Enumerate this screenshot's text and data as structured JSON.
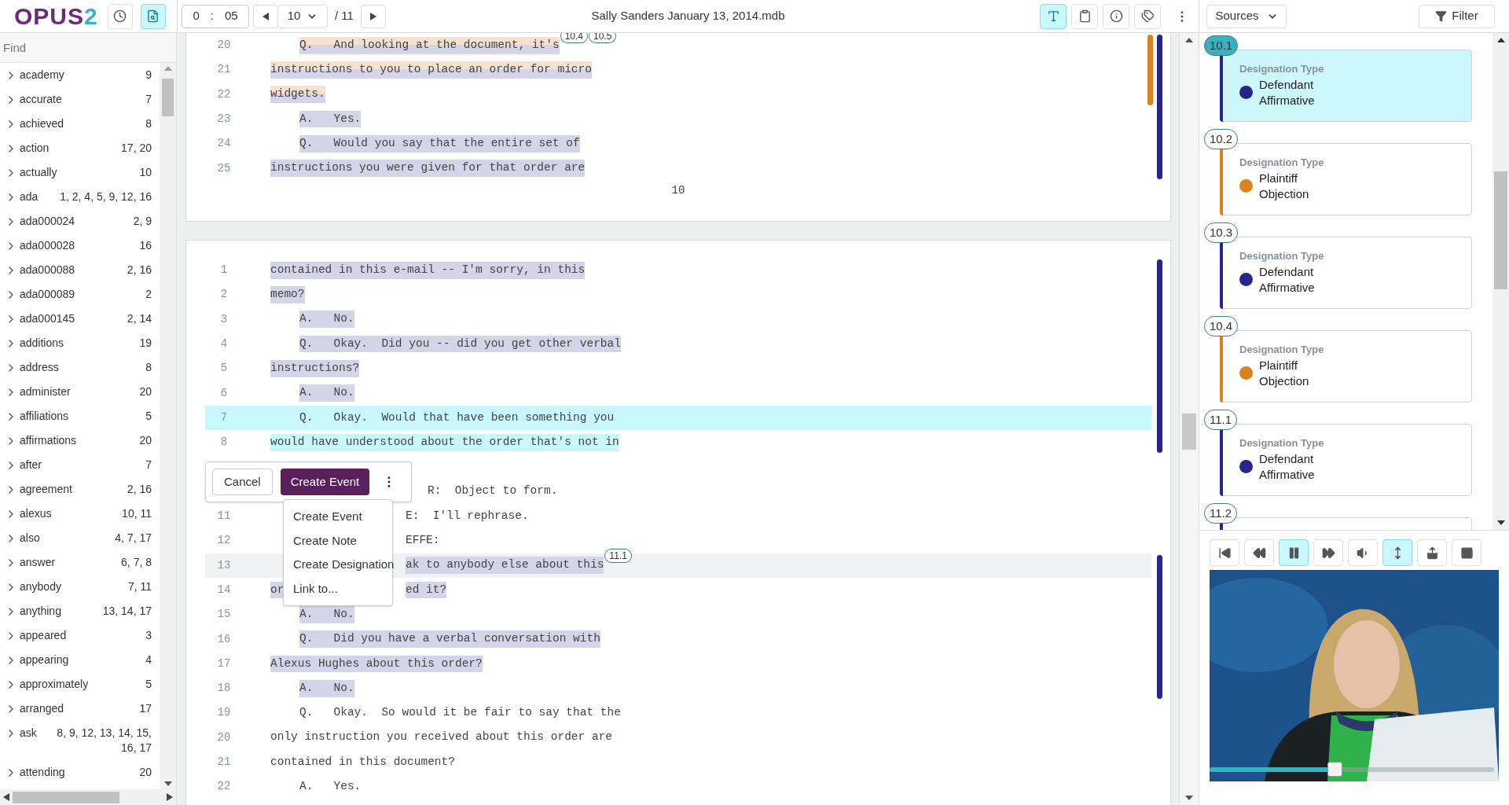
{
  "toolbar": {
    "logo": {
      "name": "OPUS",
      "number": "2"
    },
    "history_button": {
      "selected": false
    },
    "search_button": {
      "selected": true
    },
    "time": {
      "minutes": "0",
      "separator": ":",
      "seconds": "05"
    },
    "page_select": {
      "value": "10"
    },
    "page_total": "/ 11",
    "title": "Sally Sanders January 13, 2014.mdb",
    "view_buttons": [
      {
        "kind": "text",
        "selected": true
      },
      {
        "kind": "clipboard",
        "selected": false
      },
      {
        "kind": "info",
        "selected": false
      },
      {
        "kind": "tags",
        "selected": false
      }
    ],
    "sources": "Sources",
    "filter": "Filter"
  },
  "index": {
    "placeholder": "Find",
    "words": [
      {
        "word": "academy",
        "pages": "9"
      },
      {
        "word": "accurate",
        "pages": "7"
      },
      {
        "word": "achieved",
        "pages": "8"
      },
      {
        "word": "action",
        "pages": "17, 20"
      },
      {
        "word": "actually",
        "pages": "10"
      },
      {
        "word": "ada",
        "pages": "1, 2, 4, 5, 9, 12, 16"
      },
      {
        "word": "ada000024",
        "pages": "2, 9"
      },
      {
        "word": "ada000028",
        "pages": "16"
      },
      {
        "word": "ada000088",
        "pages": "2, 16"
      },
      {
        "word": "ada000089",
        "pages": "2"
      },
      {
        "word": "ada000145",
        "pages": "2, 14"
      },
      {
        "word": "additions",
        "pages": "19"
      },
      {
        "word": "address",
        "pages": "8"
      },
      {
        "word": "administer",
        "pages": "20"
      },
      {
        "word": "affiliations",
        "pages": "5"
      },
      {
        "word": "affirmations",
        "pages": "20"
      },
      {
        "word": "after",
        "pages": "7"
      },
      {
        "word": "agreement",
        "pages": "2, 16"
      },
      {
        "word": "alexus",
        "pages": "10, 11"
      },
      {
        "word": "also",
        "pages": "4, 7, 17"
      },
      {
        "word": "answer",
        "pages": "6, 7, 8"
      },
      {
        "word": "anybody",
        "pages": "7, 11"
      },
      {
        "word": "anything",
        "pages": "13, 14, 17"
      },
      {
        "word": "appeared",
        "pages": "3"
      },
      {
        "word": "appearing",
        "pages": "4"
      },
      {
        "word": "approximately",
        "pages": "5"
      },
      {
        "word": "arranged",
        "pages": "17"
      },
      {
        "word": "ask",
        "pages": "8, 9, 12, 13, 14, 15, 16, 17"
      },
      {
        "word": "attending",
        "pages": "20"
      }
    ]
  },
  "transcript": {
    "pages": [
      {
        "page_number": "10",
        "lines": [
          {
            "number": "20",
            "kind": "qa",
            "text": "Q.   And looking at the document, it's",
            "defendant": true,
            "plaintiff": true,
            "selected": false,
            "hovered": false,
            "markers": [
              "10.4",
              "10.5"
            ]
          },
          {
            "number": "21",
            "kind": "body",
            "text": "instructions to you to place an order for micro",
            "defendant": true,
            "plaintiff": true,
            "selected": false,
            "hovered": false
          },
          {
            "number": "22",
            "kind": "body",
            "text": "widgets.",
            "defendant": true,
            "plaintiff": true,
            "selected": false,
            "hovered": false
          },
          {
            "number": "23",
            "kind": "qa",
            "text": "A.   Yes.",
            "defendant": true,
            "plaintiff": false,
            "selected": false,
            "hovered": false
          },
          {
            "number": "24",
            "kind": "qa",
            "text": "Q.   Would you say that the entire set of",
            "defendant": true,
            "plaintiff": false,
            "selected": false,
            "hovered": false
          },
          {
            "number": "25",
            "kind": "body",
            "text": "instructions you were given for that order are",
            "defendant": true,
            "plaintiff": false,
            "selected": false,
            "hovered": false
          }
        ]
      },
      {
        "lines": [
          {
            "number": "1",
            "kind": "body",
            "text": "contained in this e-mail -- I'm sorry, in this",
            "defendant": true,
            "plaintiff": false,
            "selected": false,
            "hovered": false
          },
          {
            "number": "2",
            "kind": "body",
            "text": "memo?",
            "defendant": true,
            "plaintiff": false,
            "selected": false,
            "hovered": false
          },
          {
            "number": "3",
            "kind": "qa",
            "text": "A.   No.",
            "defendant": true,
            "plaintiff": false,
            "selected": false,
            "hovered": false
          },
          {
            "number": "4",
            "kind": "qa",
            "text": "Q.   Okay.  Did you -- did you get other verbal",
            "defendant": true,
            "plaintiff": false,
            "selected": false,
            "hovered": false
          },
          {
            "number": "5",
            "kind": "body",
            "text": "instructions?",
            "defendant": true,
            "plaintiff": false,
            "selected": false,
            "hovered": false
          },
          {
            "number": "6",
            "kind": "qa",
            "text": "A.   No.",
            "defendant": true,
            "plaintiff": false,
            "selected": false,
            "hovered": false
          },
          {
            "number": "7",
            "kind": "qa",
            "text": "Q.   Okay.  Would that have been something you",
            "defendant": false,
            "plaintiff": false,
            "selected": true,
            "hovered": false
          },
          {
            "number": "8",
            "kind": "body",
            "text": "would have understood about the order that's not in",
            "defendant": false,
            "plaintiff": false,
            "selected": true,
            "hovered": false
          },
          {
            "kind": "hidden"
          },
          {
            "kind": "under_card",
            "tail": "R:  Object to form.",
            "defendant": false,
            "plaintiff": false,
            "selected": false,
            "hovered": false
          },
          {
            "number": "11",
            "kind": "under_menu",
            "tail": "E:  I'll rephrase.",
            "defendant": false,
            "plaintiff": false,
            "selected": false,
            "hovered": false
          },
          {
            "number": "12",
            "kind": "under_menu",
            "tail": "EFFE:",
            "defendant": false,
            "plaintiff": false,
            "selected": false,
            "hovered": false
          },
          {
            "number": "13",
            "kind": "under_menu",
            "tail": "ak to anybody else about this",
            "defendant": true,
            "plaintiff": false,
            "selected": false,
            "hovered": true,
            "markers": [
              "11.1"
            ]
          },
          {
            "number": "14",
            "kind": "under_menu",
            "lead": "or",
            "tail": "ed it?",
            "defendant": true,
            "plaintiff": false,
            "selected": false,
            "hovered": false
          },
          {
            "number": "15",
            "kind": "qa",
            "text": "A.   No.",
            "defendant": true,
            "plaintiff": false,
            "selected": false,
            "hovered": false
          },
          {
            "number": "16",
            "kind": "qa",
            "text": "Q.   Did you have a verbal conversation with",
            "defendant": true,
            "plaintiff": false,
            "selected": false,
            "hovered": false
          },
          {
            "number": "17",
            "kind": "body",
            "text": "Alexus Hughes about this order?",
            "defendant": true,
            "plaintiff": false,
            "selected": false,
            "hovered": false
          },
          {
            "number": "18",
            "kind": "qa",
            "text": "A.   No.",
            "defendant": true,
            "plaintiff": false,
            "selected": false,
            "hovered": false
          },
          {
            "number": "19",
            "kind": "qa",
            "text": "Q.   Okay.  So would it be fair to say that the",
            "defendant": false,
            "plaintiff": false,
            "selected": false,
            "hovered": false
          },
          {
            "number": "20",
            "kind": "body",
            "text": "only instruction you received about this order are",
            "defendant": false,
            "plaintiff": false,
            "selected": false,
            "hovered": false
          },
          {
            "number": "21",
            "kind": "body",
            "text": "contained in this document?",
            "defendant": false,
            "plaintiff": false,
            "selected": false,
            "hovered": false
          },
          {
            "number": "22",
            "kind": "qa",
            "text": "A.   Yes.",
            "defendant": false,
            "plaintiff": false,
            "selected": false,
            "hovered": false
          }
        ]
      }
    ]
  },
  "popover": {
    "cancel": "Cancel",
    "create": "Create Event",
    "menu": [
      "Create Event",
      "Create Note",
      "Create Designation",
      "Link to..."
    ]
  },
  "designations": [
    {
      "label": "10.1",
      "selected": true,
      "color": "#25258b",
      "type_label": "Designation Type",
      "value": "Defendant Affirmative"
    },
    {
      "label": "10.2",
      "selected": false,
      "color": "#d9821f",
      "type_label": "Designation Type",
      "value": "Plaintiff Objection"
    },
    {
      "label": "10.3",
      "selected": false,
      "color": "#25258b",
      "type_label": "Designation Type",
      "value": "Defendant Affirmative"
    },
    {
      "label": "10.4",
      "selected": false,
      "color": "#d9821f",
      "type_label": "Designation Type",
      "value": "Plaintiff Objection"
    },
    {
      "label": "11.1",
      "selected": false,
      "color": "#25258b",
      "type_label": "Designation Type",
      "value": "Defendant Affirmative"
    },
    {
      "label": "11.2",
      "selected": false,
      "color": "#25258b"
    }
  ],
  "player": {
    "buttons": [
      {
        "kind": "skip_back",
        "selected": false
      },
      {
        "kind": "rewind",
        "selected": false
      },
      {
        "kind": "pause",
        "selected": true
      },
      {
        "kind": "forward",
        "selected": false
      },
      {
        "kind": "volume",
        "selected": false
      },
      {
        "kind": "resize",
        "selected": true
      },
      {
        "kind": "share",
        "selected": false
      },
      {
        "kind": "window",
        "selected": false
      }
    ],
    "seek": {
      "level": 0.44
    }
  }
}
